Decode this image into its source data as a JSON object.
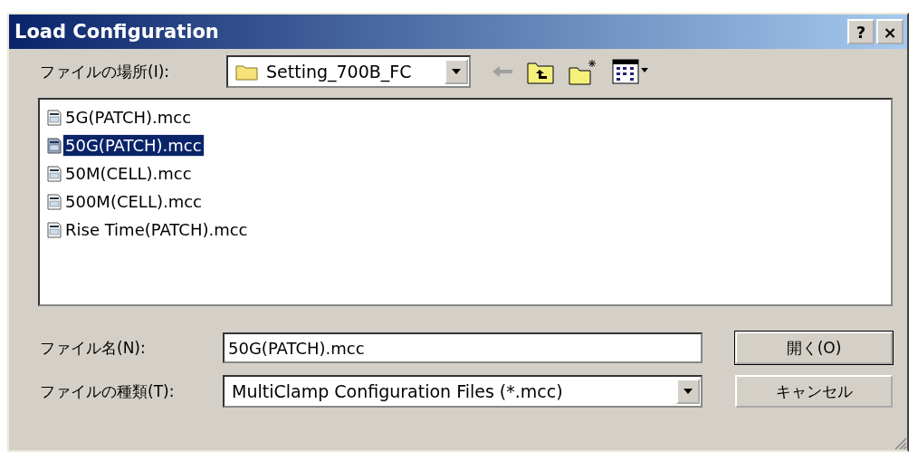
{
  "window": {
    "title": "Load Configuration",
    "title_buttons": [
      "?",
      "×"
    ]
  },
  "location": {
    "label": "ファイルの場所(I):",
    "value": "Setting_700B_FC"
  },
  "files": [
    {
      "name": "5G(PATCH).mcc",
      "selected": false
    },
    {
      "name": "50G(PATCH).mcc",
      "selected": true
    },
    {
      "name": "50M(CELL).mcc",
      "selected": false
    },
    {
      "name": "500M(CELL).mcc",
      "selected": false
    },
    {
      "name": "Rise Time(PATCH).mcc",
      "selected": false
    }
  ],
  "filename": {
    "label": "ファイル名(N):",
    "value": "50G(PATCH).mcc"
  },
  "filetype": {
    "label": "ファイルの種類(T):",
    "value": "MultiClamp Configuration Files (*.mcc)"
  },
  "buttons": [
    "開く(O)",
    "キャンセル"
  ]
}
